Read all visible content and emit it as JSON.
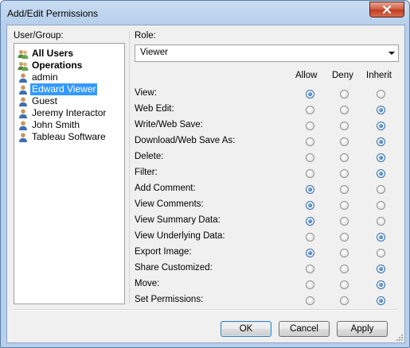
{
  "window": {
    "title": "Add/Edit Permissions"
  },
  "users": {
    "label": "User/Group:",
    "items": [
      {
        "name": "All Users",
        "type": "group",
        "bold": true,
        "selected": false
      },
      {
        "name": "Operations",
        "type": "group",
        "bold": true,
        "selected": false
      },
      {
        "name": "admin",
        "type": "user",
        "bold": false,
        "selected": false
      },
      {
        "name": "Edward Viewer",
        "type": "user",
        "bold": false,
        "selected": true
      },
      {
        "name": "Guest",
        "type": "user",
        "bold": false,
        "selected": false
      },
      {
        "name": "Jeremy Interactor",
        "type": "user",
        "bold": false,
        "selected": false
      },
      {
        "name": "John Smith",
        "type": "user",
        "bold": false,
        "selected": false
      },
      {
        "name": "Tableau Software",
        "type": "user",
        "bold": false,
        "selected": false
      }
    ]
  },
  "role": {
    "label": "Role:",
    "value": "Viewer"
  },
  "columns": {
    "allow": "Allow",
    "deny": "Deny",
    "inherit": "Inherit"
  },
  "permissions": [
    {
      "label": "View:",
      "value": "allow"
    },
    {
      "label": "Web Edit:",
      "value": "inherit"
    },
    {
      "label": "Write/Web Save:",
      "value": "inherit"
    },
    {
      "label": "Download/Web Save As:",
      "value": "inherit"
    },
    {
      "label": "Delete:",
      "value": "inherit"
    },
    {
      "label": "Filter:",
      "value": "inherit"
    },
    {
      "label": "Add Comment:",
      "value": "allow"
    },
    {
      "label": "View Comments:",
      "value": "allow"
    },
    {
      "label": "View Summary Data:",
      "value": "allow"
    },
    {
      "label": "View Underlying Data:",
      "value": "inherit"
    },
    {
      "label": "Export Image:",
      "value": "allow"
    },
    {
      "label": "Share Customized:",
      "value": "inherit"
    },
    {
      "label": "Move:",
      "value": "inherit"
    },
    {
      "label": "Set Permissions:",
      "value": "inherit"
    }
  ],
  "buttons": {
    "ok": "OK",
    "cancel": "Cancel",
    "apply": "Apply"
  },
  "colors": {
    "selection": "#3399ff",
    "radio_on": "#1f5ea8",
    "close": "#c7432a"
  }
}
